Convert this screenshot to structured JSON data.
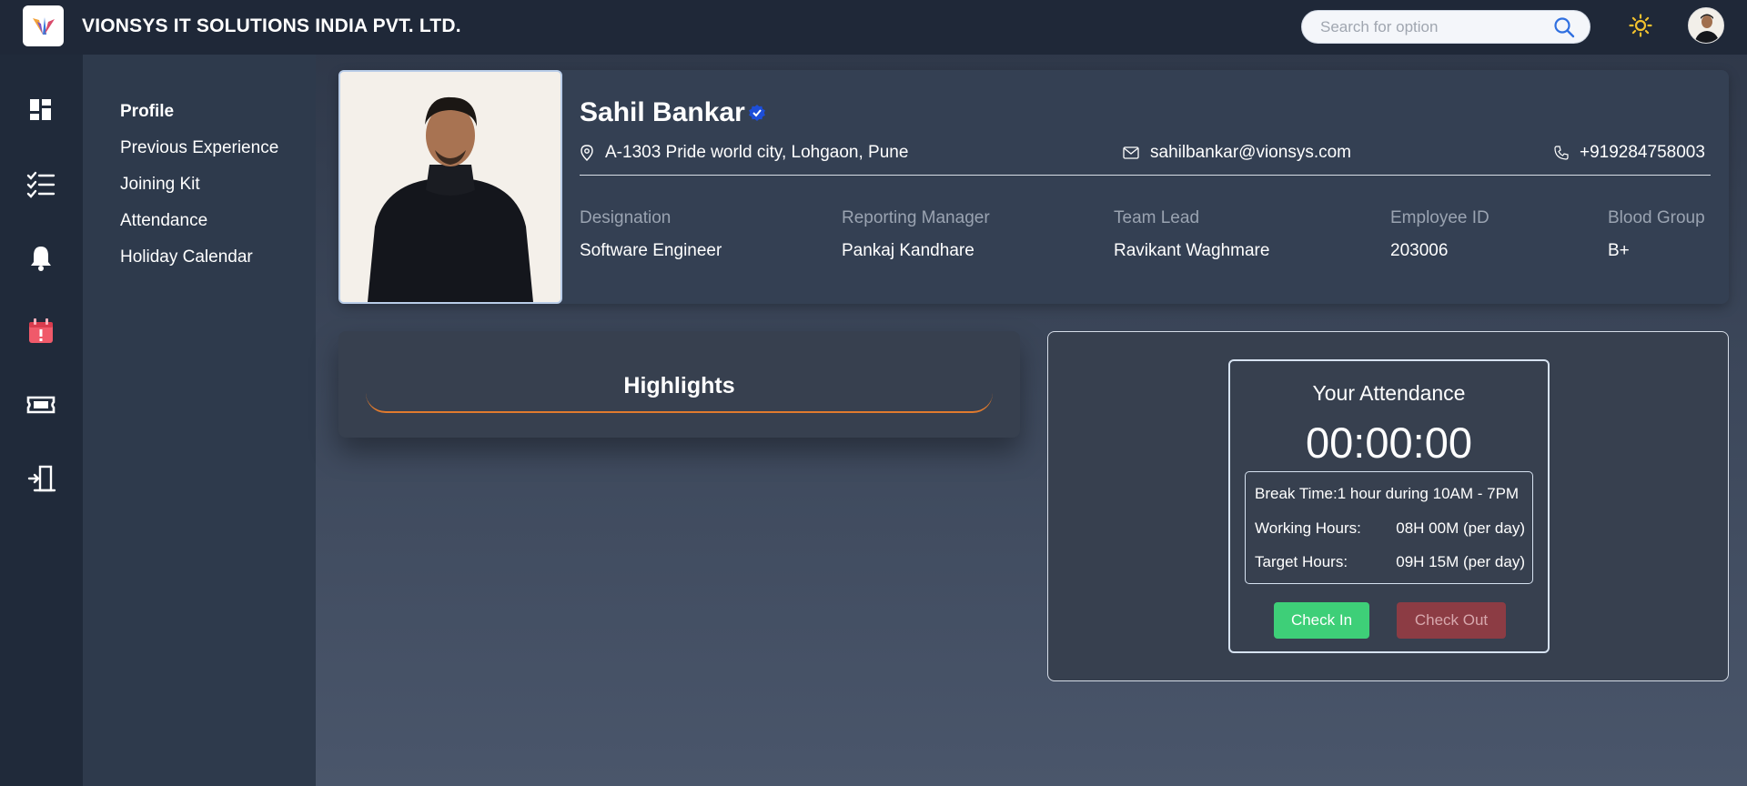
{
  "header": {
    "company": "VIONSYS IT SOLUTIONS INDIA PVT. LTD.",
    "search_placeholder": "Search for option"
  },
  "rail": {
    "icons": [
      "dashboard-icon",
      "task-list-icon",
      "bell-icon",
      "calendar-alert-icon",
      "ticket-icon",
      "logout-icon"
    ]
  },
  "submenu": {
    "items": [
      "Profile",
      "Previous Experience",
      "Joining Kit",
      "Attendance",
      "Holiday Calendar"
    ],
    "active": "Profile"
  },
  "profile": {
    "name": "Sahil Bankar",
    "address": "A-1303 Pride world city, Lohgaon, Pune",
    "email": "sahilbankar@vionsys.com",
    "phone": "+919284758003",
    "fields": [
      {
        "label": "Designation",
        "value": "Software Engineer"
      },
      {
        "label": "Reporting Manager",
        "value": "Pankaj Kandhare"
      },
      {
        "label": "Team Lead",
        "value": "Ravikant Waghmare"
      },
      {
        "label": "Employee ID",
        "value": "203006"
      },
      {
        "label": "Blood Group",
        "value": "B+"
      }
    ]
  },
  "highlights": {
    "title": "Highlights"
  },
  "attendance": {
    "title": "Your Attendance",
    "timer": "00:00:00",
    "break_label": "Break Time:",
    "break_value": "1 hour during 10AM - 7PM",
    "working_label": "Working Hours:",
    "working_value": "08H 00M (per day)",
    "target_label": "Target Hours:",
    "target_value": "09H 15M (per day)",
    "check_in": "Check In",
    "check_out": "Check Out"
  },
  "colors": {
    "topbar": "#1f2838",
    "accent_orange": "#e07a2e",
    "check_in": "#3ecf78",
    "check_out": "#8c3c44",
    "verified_blue": "#1d4ed8"
  }
}
